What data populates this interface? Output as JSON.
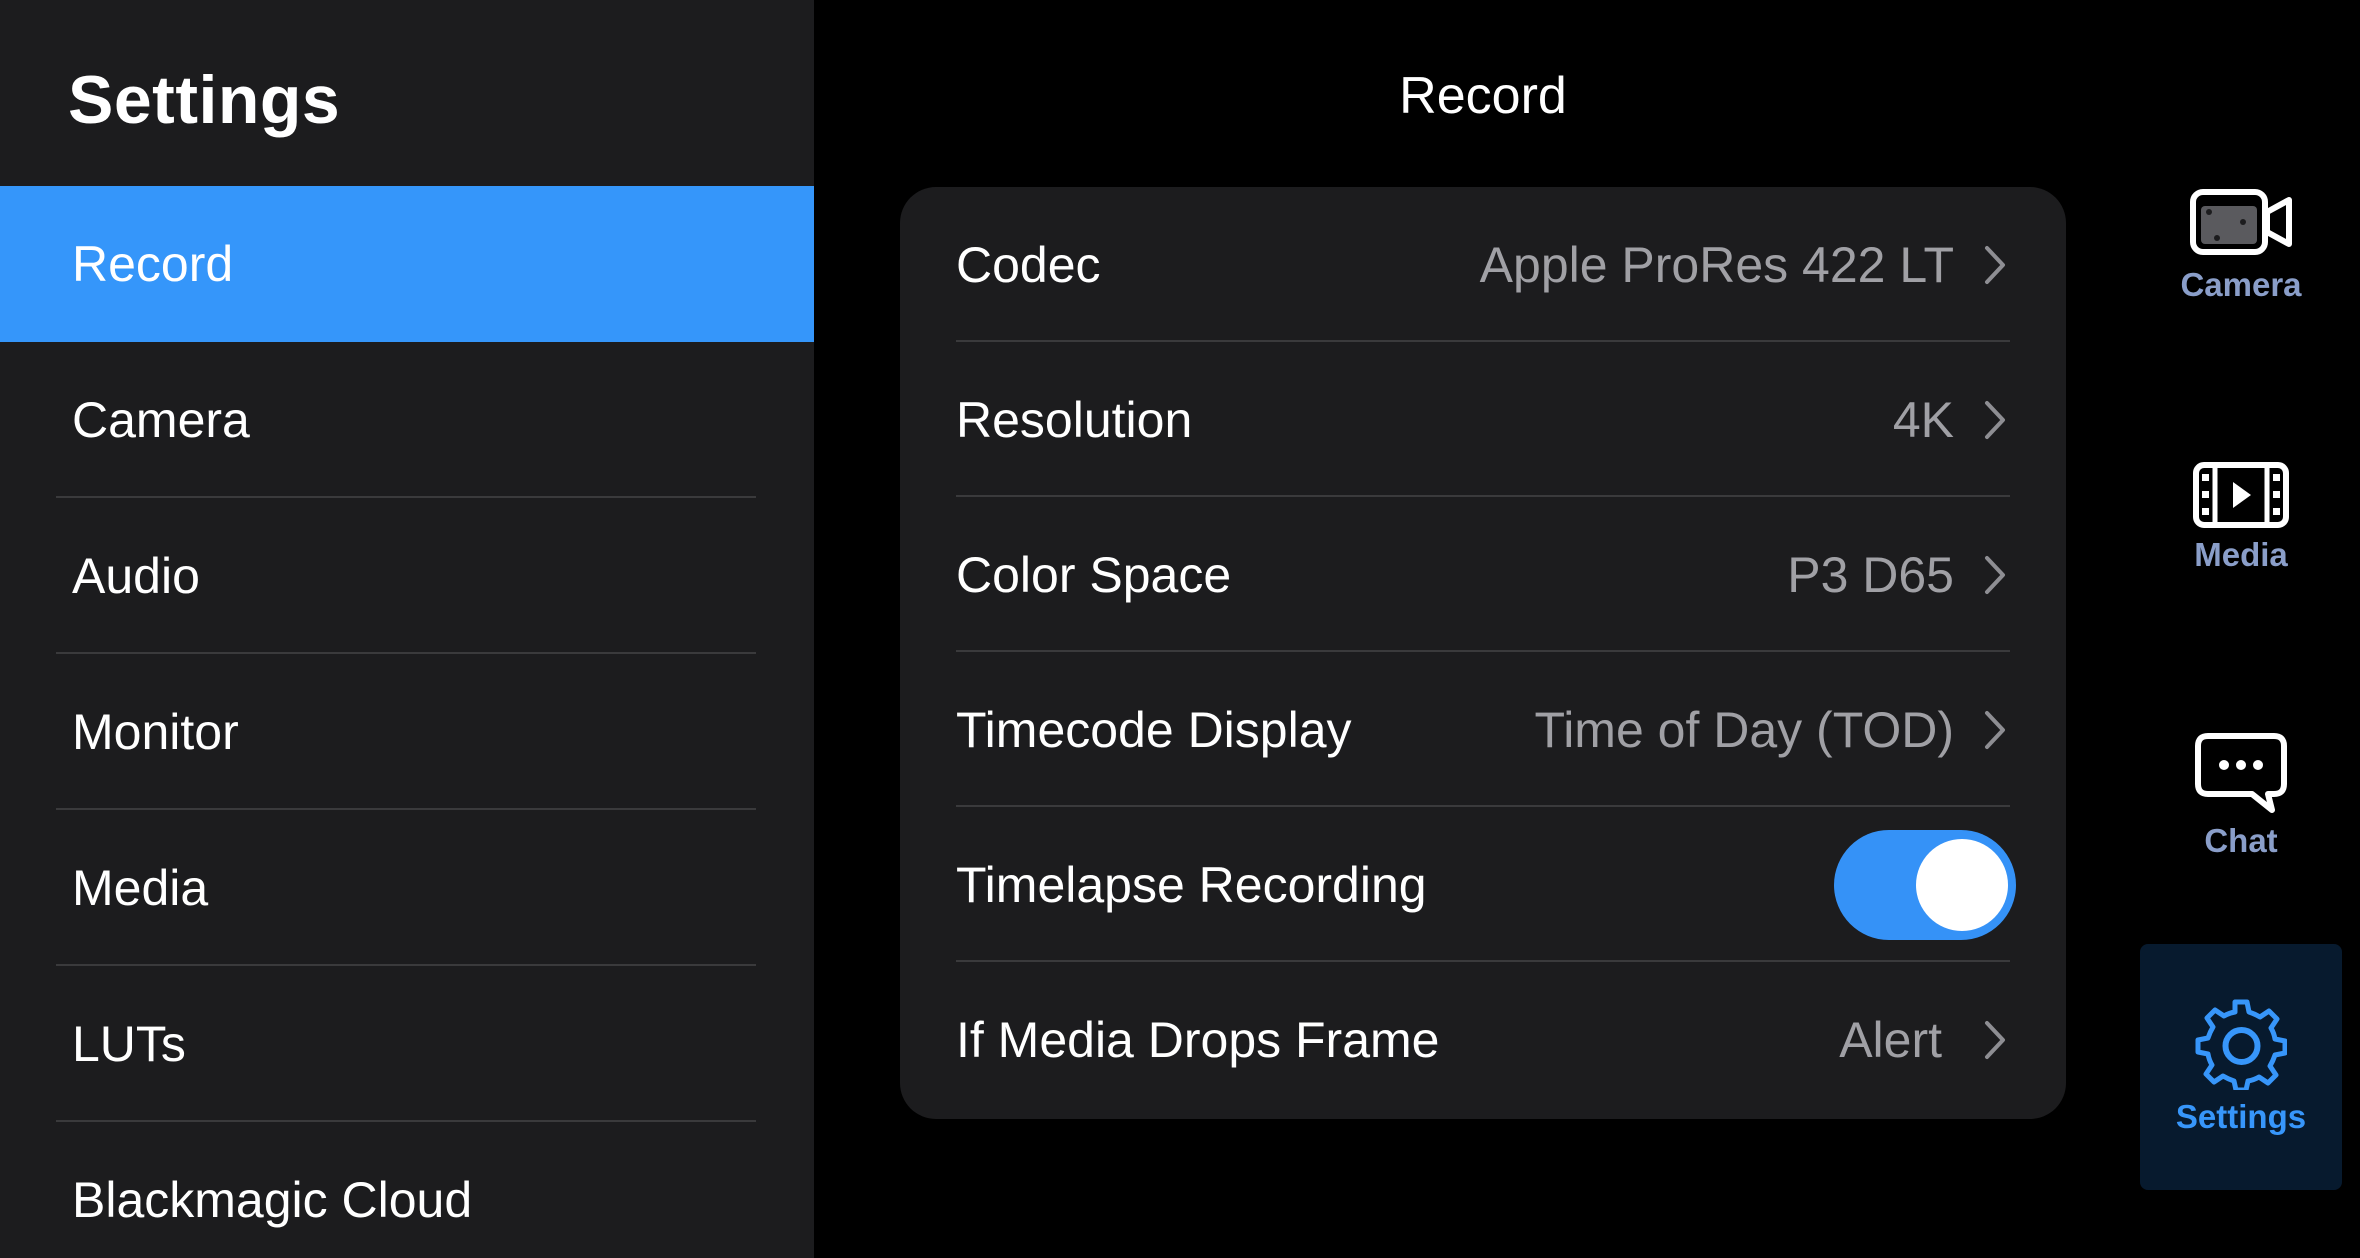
{
  "sidebar": {
    "title": "Settings",
    "items": [
      {
        "label": "Record",
        "active": true
      },
      {
        "label": "Camera"
      },
      {
        "label": "Audio"
      },
      {
        "label": "Monitor"
      },
      {
        "label": "Media"
      },
      {
        "label": "LUTs"
      },
      {
        "label": "Blackmagic Cloud"
      }
    ]
  },
  "main": {
    "title": "Record",
    "rows": [
      {
        "label": "Codec",
        "value": "Apple ProRes 422 LT"
      },
      {
        "label": "Resolution",
        "value": "4K"
      },
      {
        "label": "Color Space",
        "value": "P3 D65"
      },
      {
        "label": "Timecode Display",
        "value": "Time of Day (TOD)"
      },
      {
        "label": "Timelapse Recording",
        "toggle_on": true
      },
      {
        "label": "If Media Drops Frame",
        "value": "Alert"
      }
    ]
  },
  "tabbar": {
    "tabs": [
      {
        "label": "Camera",
        "icon": "video-camera-icon"
      },
      {
        "label": "Media",
        "icon": "film-play-icon"
      },
      {
        "label": "Chat",
        "icon": "chat-bubble-icon"
      },
      {
        "label": "Settings",
        "icon": "gear-icon",
        "active": true
      }
    ]
  },
  "colors": {
    "accent": "#3596fa",
    "background": "#000000",
    "panel": "#1c1c1e",
    "secondary_text": "#a0a0a5",
    "tab_inactive": "#8a9ec9"
  }
}
